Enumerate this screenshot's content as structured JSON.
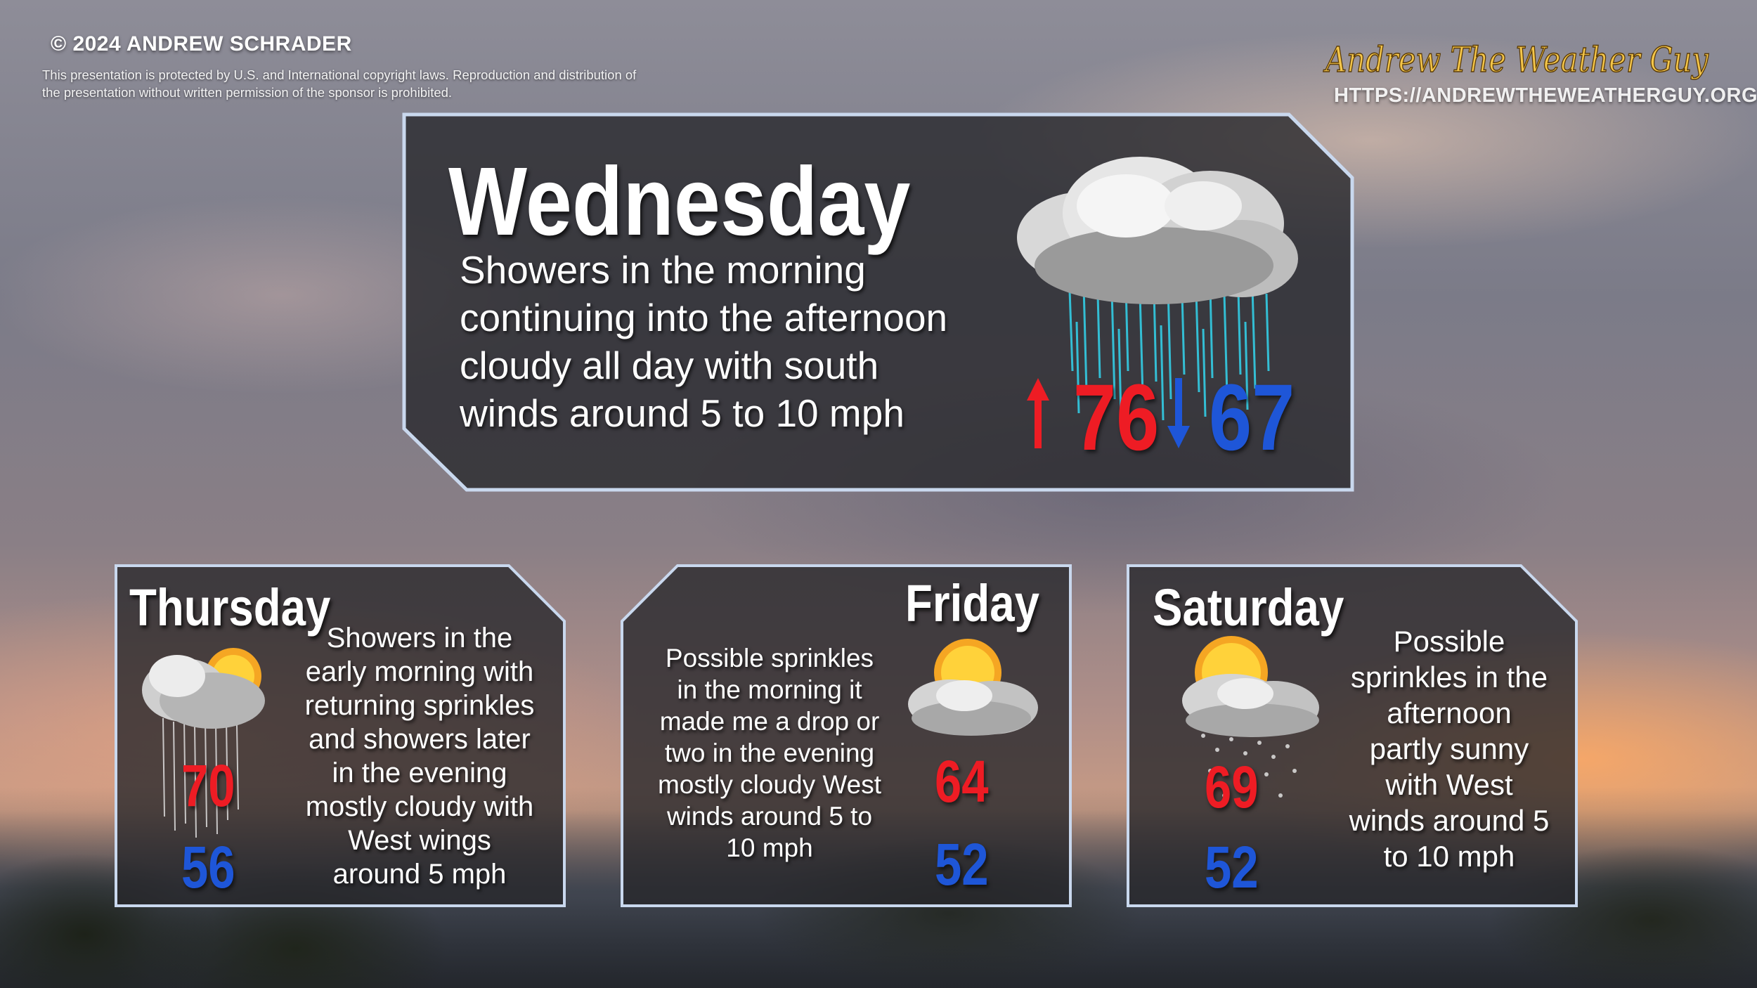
{
  "header": {
    "copyright": "© 2024 ANDREW SCHRADER",
    "legal_line1": "This presentation is protected by U.S. and International copyright laws. Reproduction and distribution of",
    "legal_line2": "the presentation without written permission of the sponsor is prohibited.",
    "brand_name": "Andrew The Weather Guy",
    "brand_url": "HTTPS://ANDREWTHEWEATHERGUY.ORG"
  },
  "colors": {
    "high_temp": "#ee1c24",
    "low_temp": "#1e56d8",
    "panel_border": "#c9d8ee",
    "brand_gold": "#f4c64a"
  },
  "forecast": {
    "wednesday": {
      "day": "Wednesday",
      "lines": [
        "Showers in the morning",
        "continuing into the afternoon",
        "cloudy all day with south",
        "winds around 5 to 10 mph"
      ],
      "high": "76",
      "low": "67",
      "icon": "rain-cloud-icon"
    },
    "thursday": {
      "day": "Thursday",
      "lines": [
        "Showers in the",
        "early morning with",
        "returning sprinkles",
        "and showers later",
        "in the evening",
        "mostly cloudy with",
        "West wings",
        "around 5 mph"
      ],
      "high": "70",
      "low": "56",
      "icon": "sun-cloud-rain-icon"
    },
    "friday": {
      "day": "Friday",
      "lines": [
        "Possible sprinkles",
        "in the morning it",
        "made me a drop or",
        "two in the evening",
        "mostly cloudy West",
        "winds around 5 to",
        "10 mph"
      ],
      "high": "64",
      "low": "52",
      "icon": "sun-cloud-icon"
    },
    "saturday": {
      "day": "Saturday",
      "lines": [
        "Possible",
        "sprinkles in the",
        "afternoon",
        "partly sunny",
        "with West",
        "winds around 5",
        "to 10 mph"
      ],
      "high": "69",
      "low": "52",
      "icon": "sun-cloud-drizzle-icon"
    }
  }
}
